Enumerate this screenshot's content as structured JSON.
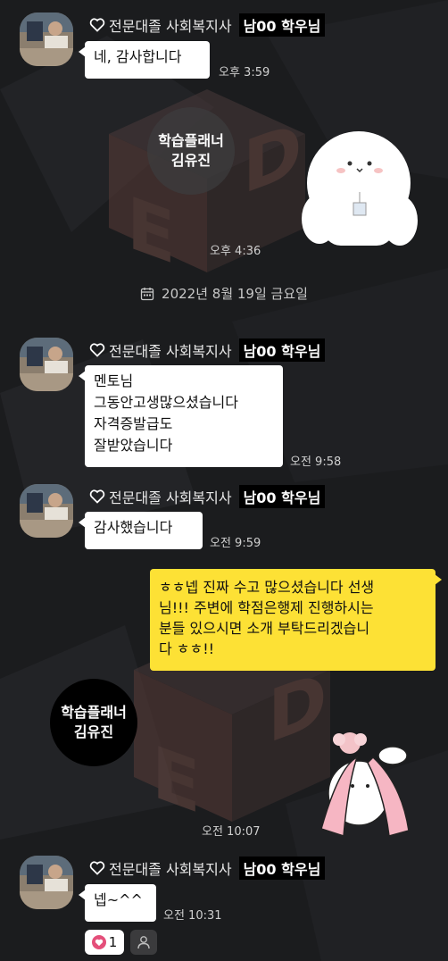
{
  "sender": {
    "prefix": "전문대졸 사회복지사",
    "badge": "남00 학우님"
  },
  "messages": [
    {
      "lines": [
        "네, 감사합니다"
      ],
      "time": "오후 3:59"
    },
    {
      "time": "오후 4:36"
    },
    {
      "lines": [
        "멘토님",
        "그동안고생많으셨습니다",
        "자격증발급도",
        "잘받았습니다"
      ],
      "time": "오전 9:58"
    },
    {
      "lines": [
        "감사했습니다"
      ],
      "time": "오전 9:59"
    },
    {
      "lines": [
        "ㅎㅎ넵 진짜 수고 많으셨습니다 선생",
        "님!!! 주변에 학점은행제 진행하시는",
        "분들 있으시면 소개 부탁드리겠습니",
        "다 ㅎㅎ!!"
      ]
    },
    {
      "time": "오전 10:07"
    },
    {
      "lines": [
        "넵~^^"
      ],
      "time": "오전 10:31"
    }
  ],
  "planner": {
    "line1": "학습플래너",
    "line2": "김유진"
  },
  "date_separator": "2022년 8월 19일 금요일",
  "reaction": {
    "count": "1"
  },
  "colors": {
    "yellow_bubble": "#fde135",
    "background": "#1b1c1e",
    "reaction_heart": "#e44f7a"
  },
  "icons": [
    "heart-outline-icon",
    "calendar-icon",
    "heart-reaction-icon",
    "person-icon"
  ]
}
